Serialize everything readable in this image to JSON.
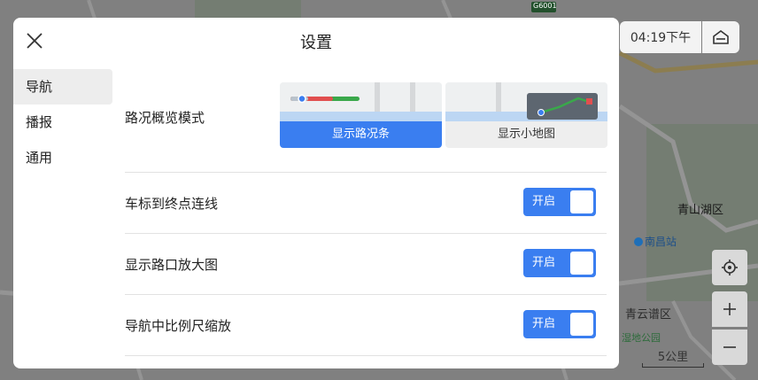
{
  "dialog": {
    "title": "设置",
    "nav": [
      {
        "label": "导航",
        "active": true
      },
      {
        "label": "播报",
        "active": false
      },
      {
        "label": "通用",
        "active": false
      }
    ],
    "overview_mode": {
      "label": "路况概览模式",
      "options": [
        {
          "label": "显示路况条",
          "selected": true
        },
        {
          "label": "显示小地图",
          "selected": false
        }
      ]
    },
    "toggles": [
      {
        "label": "车标到终点连线",
        "state_label": "开启",
        "on": true
      },
      {
        "label": "显示路口放大图",
        "state_label": "开启",
        "on": true
      },
      {
        "label": "导航中比例尺缩放",
        "state_label": "开启",
        "on": true
      }
    ]
  },
  "map": {
    "time": "04:19下午",
    "labels": {
      "district": "青山湖区",
      "station": "南昌站",
      "qingyun": "青云谱区",
      "park": "湿地公园",
      "road_badge": "G6001"
    },
    "scale": "5公里"
  },
  "colors": {
    "accent": "#3a7ef0"
  }
}
